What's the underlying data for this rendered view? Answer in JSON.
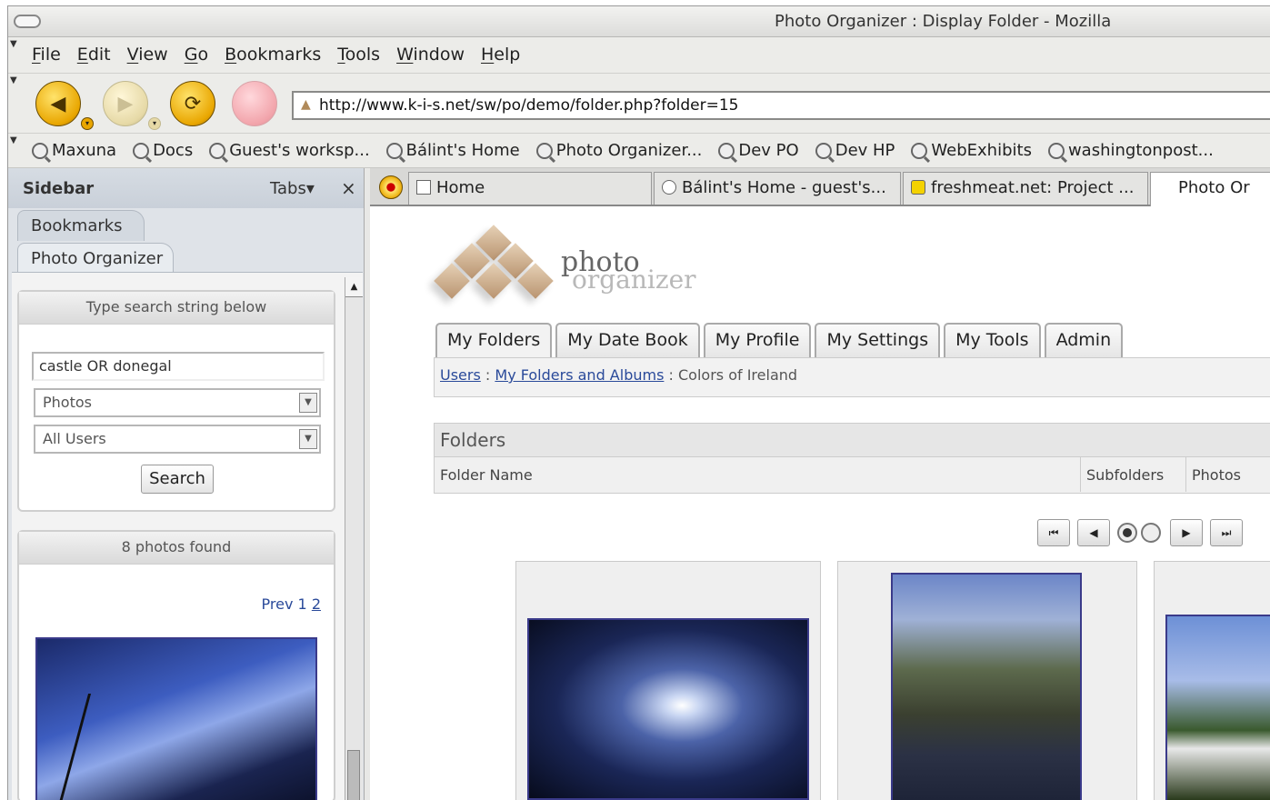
{
  "window": {
    "title": "Photo Organizer : Display Folder - Mozilla"
  },
  "menu": [
    "File",
    "Edit",
    "View",
    "Go",
    "Bookmarks",
    "Tools",
    "Window",
    "Help"
  ],
  "nav": {
    "url": "http://www.k-i-s.net/sw/po/demo/folder.php?folder=15"
  },
  "bookmarks": [
    "Maxuna",
    "Docs",
    "Guest's worksp...",
    "Bálint's Home",
    "Photo Organizer...",
    "Dev PO",
    "Dev HP",
    "WebExhibits",
    "washingtonpost..."
  ],
  "sidebar": {
    "title": "Sidebar",
    "tabs_label": "Tabs",
    "close": "×",
    "panels": [
      "Bookmarks",
      "Photo Organizer"
    ],
    "search": {
      "header": "Type search string below",
      "query": "castle OR donegal",
      "type_select": "Photos",
      "user_select": "All Users",
      "button": "Search"
    },
    "results": {
      "header": "8 photos found",
      "prev": "Prev",
      "page1": "1",
      "page2": "2"
    }
  },
  "tabs": [
    {
      "label": "Home"
    },
    {
      "label": "Bálint's Home - guest's..."
    },
    {
      "label": "freshmeat.net: Project ..."
    },
    {
      "label": "Photo Or"
    }
  ],
  "page": {
    "logo": {
      "line1": "photo",
      "line2": "organizer"
    },
    "nav_tabs": [
      "My Folders",
      "My Date Book",
      "My Profile",
      "My Settings",
      "My Tools",
      "Admin"
    ],
    "breadcrumb": {
      "users": "Users",
      "sep": ":",
      "folders": "My Folders and Albums",
      "current": "Colors of Ireland"
    },
    "folders": {
      "title": "Folders",
      "col_name": "Folder Name",
      "col_subfolders": "Subfolders",
      "col_photos": "Photos"
    }
  }
}
